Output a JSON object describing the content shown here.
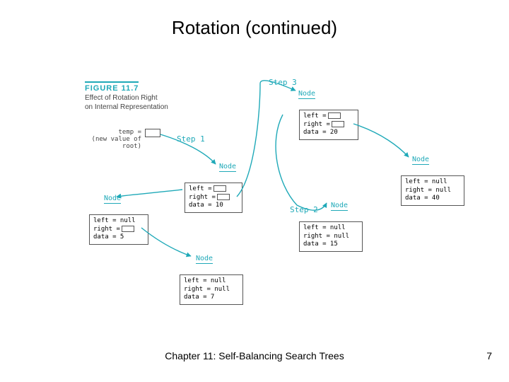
{
  "title": "Rotation (continued)",
  "footer": "Chapter 11: Self-Balancing Search Trees",
  "page": "7",
  "figure": {
    "number": "FIGURE 11.7",
    "caption_line1": "Effect of Rotation Right",
    "caption_line2": "on Internal Representation"
  },
  "temp": {
    "line1": "temp =",
    "line2": "(new value of root)"
  },
  "steps": {
    "s1": "Step 1",
    "s2": "Step 2",
    "s3": "Step 3"
  },
  "labels": {
    "node": "Node"
  },
  "boxes": {
    "b20": {
      "l1": "left =",
      "l2": "right =",
      "l3": "data = 20"
    },
    "b10": {
      "l1": "left =",
      "l2": "right =",
      "l3": "data = 10"
    },
    "b40": {
      "l1": "left = null",
      "l2": "right = null",
      "l3": "data = 40"
    },
    "b5": {
      "l1": "left = null",
      "l2": "right =",
      "l3": "data = 5"
    },
    "b15": {
      "l1": "left = null",
      "l2": "right = null",
      "l3": "data = 15"
    },
    "b7": {
      "l1": "left = null",
      "l2": "right = null",
      "l3": "data = 7"
    }
  }
}
